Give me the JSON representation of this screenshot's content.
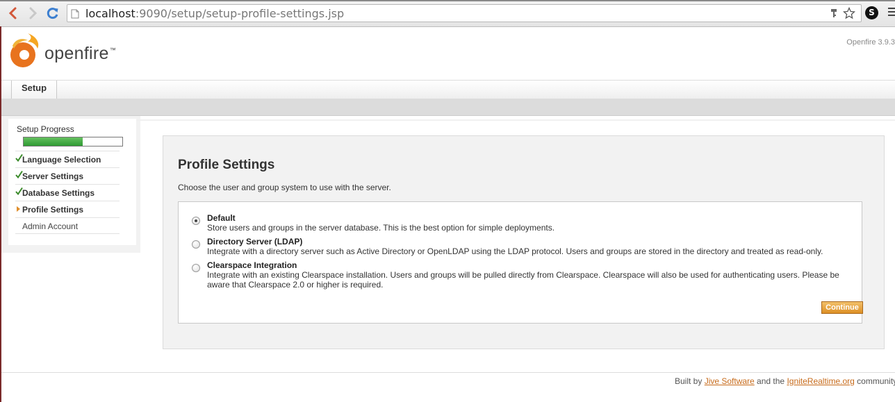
{
  "browser": {
    "url_host": "localhost",
    "url_rest": ":9090/setup/setup-profile-settings.jsp",
    "extension_letter": "S"
  },
  "header": {
    "logo_text": "openfire",
    "logo_tm": "™",
    "version": "Openfire 3.9.3"
  },
  "tabs": [
    {
      "label": "Setup"
    }
  ],
  "sidebar": {
    "title": "Setup Progress",
    "progress_fraction": 0.6,
    "items": [
      {
        "label": "Language Selection",
        "state": "done"
      },
      {
        "label": "Server Settings",
        "state": "done"
      },
      {
        "label": "Database Settings",
        "state": "done"
      },
      {
        "label": "Profile Settings",
        "state": "current"
      },
      {
        "label": "Admin Account",
        "state": "pending"
      }
    ]
  },
  "main": {
    "title": "Profile Settings",
    "description": "Choose the user and group system to use with the server.",
    "options": [
      {
        "title": "Default",
        "description": "Store users and groups in the server database. This is the best option for simple deployments.",
        "selected": true
      },
      {
        "title": "Directory Server (LDAP)",
        "description": "Integrate with a directory server such as Active Directory or OpenLDAP using the LDAP protocol. Users and groups are stored in the directory and treated as read-only.",
        "selected": false
      },
      {
        "title": "Clearspace Integration",
        "description": "Integrate with an existing Clearspace installation. Users and groups will be pulled directly from Clearspace. Clearspace will also be used for authenticating users. Please be aware that Clearspace 2.0 or higher is required.",
        "selected": false
      }
    ],
    "continue_label": "Continue"
  },
  "footer": {
    "prefix": "Built by ",
    "link1": "Jive Software",
    "middle": " and the ",
    "link2": "IgniteRealtime.org",
    "suffix": " community"
  },
  "colors": {
    "accent": "#e08e2b",
    "progress_green": "#3aa23a",
    "check_green": "#3a8a2a"
  }
}
